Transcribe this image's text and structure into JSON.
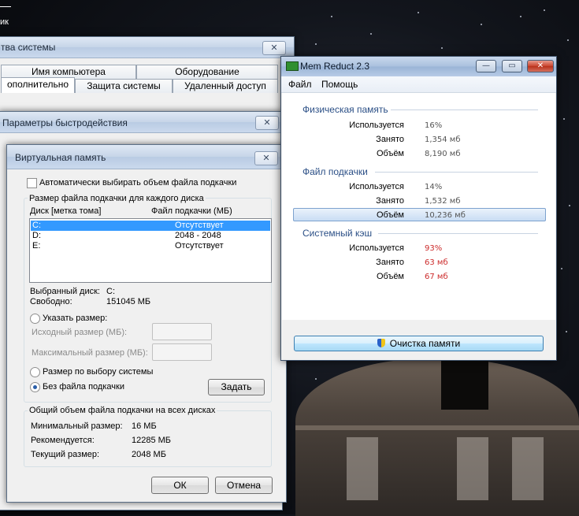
{
  "desktop": {
    "corner_text": "ик"
  },
  "system_props": {
    "title": "тва системы",
    "tabs_row1": [
      "Имя компьютера",
      "Оборудование"
    ],
    "tabs_row2": [
      "ополнительно",
      "Защита системы",
      "Удаленный доступ"
    ]
  },
  "perf_options": {
    "title": "Параметры быстродействия"
  },
  "virtual_memory": {
    "title": "Виртуальная память",
    "auto_checkbox_label": "Автоматически выбирать объем файла подкачки",
    "per_disk_group_label": "Размер файла подкачки для каждого диска",
    "col_drive": "Диск [метка тома]",
    "col_pagefile": "Файл подкачки (МБ)",
    "drives": [
      {
        "drive": "C:",
        "pagefile": "Отсутствует"
      },
      {
        "drive": "D:",
        "pagefile": "2048 - 2048"
      },
      {
        "drive": "E:",
        "pagefile": "Отсутствует"
      }
    ],
    "selected_disk_label": "Выбранный диск:",
    "selected_disk_value": "C:",
    "free_label": "Свободно:",
    "free_value": "151045 МБ",
    "custom_size_label": "Указать размер:",
    "initial_size_label": "Исходный размер (МБ):",
    "max_size_label": "Максимальный размер (МБ):",
    "system_managed_label": "Размер по выбору системы",
    "no_paging_label": "Без файла подкачки",
    "set_button": "Задать",
    "total_group_label": "Общий объем файла подкачки на всех дисках",
    "min_size_label": "Минимальный размер:",
    "min_size_value": "16 МБ",
    "recommended_label": "Рекомендуется:",
    "recommended_value": "12285 МБ",
    "current_label": "Текущий размер:",
    "current_value": "2048 МБ",
    "ok_button": "ОК",
    "cancel_button": "Отмена"
  },
  "mem_reduct": {
    "title": "Mem Reduct 2.3",
    "menu": [
      "Файл",
      "Помощь"
    ],
    "sections": [
      {
        "name": "Физическая память",
        "rows": [
          {
            "label": "Используется",
            "value": "16%"
          },
          {
            "label": "Занято",
            "value": "1,354 мб"
          },
          {
            "label": "Объём",
            "value": "8,190 мб"
          }
        ]
      },
      {
        "name": "Файл подкачки",
        "rows": [
          {
            "label": "Используется",
            "value": "14%"
          },
          {
            "label": "Занято",
            "value": "1,532 мб"
          },
          {
            "label": "Объём",
            "value": "10,236 мб"
          }
        ]
      },
      {
        "name": "Системный кэш",
        "rows": [
          {
            "label": "Используется",
            "value": "93%"
          },
          {
            "label": "Занято",
            "value": "63 мб"
          },
          {
            "label": "Объём",
            "value": "67 мб"
          }
        ]
      }
    ],
    "clean_button": "Очистка памяти",
    "colors": {
      "section_header": "#2b4f86",
      "warning_value": "#cc2b2b"
    }
  }
}
